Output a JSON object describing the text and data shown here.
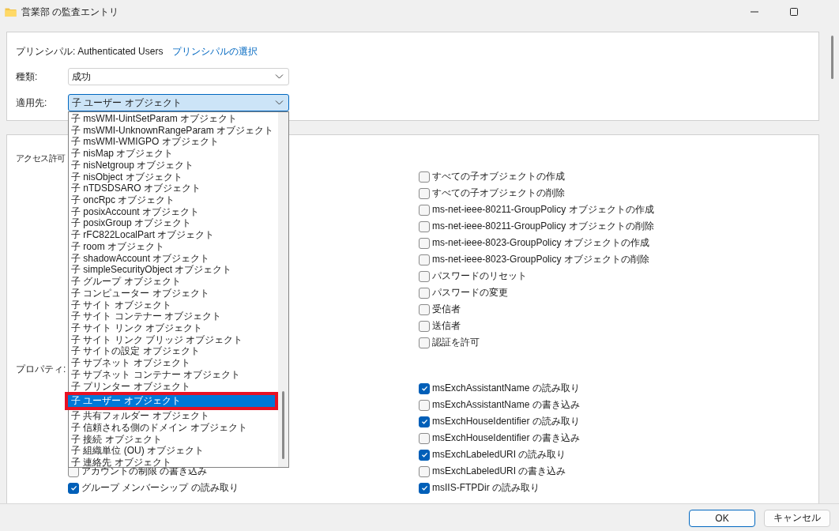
{
  "window": {
    "title": "営業部 の監査エントリ"
  },
  "principal": {
    "label": "プリンシパル:",
    "value": "Authenticated Users",
    "link": "プリンシパルの選択"
  },
  "type": {
    "label": "種類:",
    "value": "成功"
  },
  "applies_to": {
    "label": "適用先:",
    "value": "子 ユーザー オブジェクト",
    "expanded": true,
    "options": [
      {
        "label": "子 msWMI-UintSetParam オブジェクト",
        "selected": false,
        "highlighted": false
      },
      {
        "label": "子 msWMI-UnknownRangeParam オブジェクト",
        "selected": false,
        "highlighted": false
      },
      {
        "label": "子 msWMI-WMIGPO オブジェクト",
        "selected": false,
        "highlighted": false
      },
      {
        "label": "子 nisMap オブジェクト",
        "selected": false,
        "highlighted": false
      },
      {
        "label": "子 nisNetgroup オブジェクト",
        "selected": false,
        "highlighted": false
      },
      {
        "label": "子 nisObject オブジェクト",
        "selected": false,
        "highlighted": false
      },
      {
        "label": "子 nTDSDSARO オブジェクト",
        "selected": false,
        "highlighted": false
      },
      {
        "label": "子 oncRpc オブジェクト",
        "selected": false,
        "highlighted": false
      },
      {
        "label": "子 posixAccount オブジェクト",
        "selected": false,
        "highlighted": false
      },
      {
        "label": "子 posixGroup オブジェクト",
        "selected": false,
        "highlighted": false
      },
      {
        "label": "子 rFC822LocalPart オブジェクト",
        "selected": false,
        "highlighted": false
      },
      {
        "label": "子 room オブジェクト",
        "selected": false,
        "highlighted": false
      },
      {
        "label": "子 shadowAccount オブジェクト",
        "selected": false,
        "highlighted": false
      },
      {
        "label": "子 simpleSecurityObject オブジェクト",
        "selected": false,
        "highlighted": false
      },
      {
        "label": "子 グループ オブジェクト",
        "selected": false,
        "highlighted": false
      },
      {
        "label": "子 コンピューター オブジェクト",
        "selected": false,
        "highlighted": false
      },
      {
        "label": "子 サイト オブジェクト",
        "selected": false,
        "highlighted": false
      },
      {
        "label": "子 サイト コンテナー オブジェクト",
        "selected": false,
        "highlighted": false
      },
      {
        "label": "子 サイト リンク オブジェクト",
        "selected": false,
        "highlighted": false
      },
      {
        "label": "子 サイト リンク ブリッジ オブジェクト",
        "selected": false,
        "highlighted": false
      },
      {
        "label": "子 サイトの設定 オブジェクト",
        "selected": false,
        "highlighted": false
      },
      {
        "label": "子 サブネット オブジェクト",
        "selected": false,
        "highlighted": false
      },
      {
        "label": "子 サブネット コンテナー オブジェクト",
        "selected": false,
        "highlighted": false
      },
      {
        "label": "子 プリンター オブジェクト",
        "selected": false,
        "highlighted": false
      },
      {
        "label": "子 ユーザー オブジェクト",
        "selected": true,
        "highlighted": true
      },
      {
        "label": "子 共有フォルダー オブジェクト",
        "selected": false,
        "highlighted": false
      },
      {
        "label": "子 信頼される側のドメイン オブジェクト",
        "selected": false,
        "highlighted": false
      },
      {
        "label": "子 接続 オブジェクト",
        "selected": false,
        "highlighted": false
      },
      {
        "label": "子 組織単位 (OU) オブジェクト",
        "selected": false,
        "highlighted": false
      },
      {
        "label": "子 連絡先 オブジェクト",
        "selected": false,
        "highlighted": false
      }
    ]
  },
  "permissions": {
    "label": "アクセス許可",
    "items": [
      {
        "label": "すべての子オブジェクトの作成",
        "checked": false
      },
      {
        "label": "すべての子オブジェクトの削除",
        "checked": false
      },
      {
        "label": "ms-net-ieee-80211-GroupPolicy オブジェクトの作成",
        "checked": false
      },
      {
        "label": "ms-net-ieee-80211-GroupPolicy オブジェクトの削除",
        "checked": false
      },
      {
        "label": "ms-net-ieee-8023-GroupPolicy オブジェクトの作成",
        "checked": false
      },
      {
        "label": "ms-net-ieee-8023-GroupPolicy オブジェクトの削除",
        "checked": false
      },
      {
        "label": "パスワードのリセット",
        "checked": false
      },
      {
        "label": "パスワードの変更",
        "checked": false
      },
      {
        "label": "受信者",
        "checked": false
      },
      {
        "label": "送信者",
        "checked": false
      },
      {
        "label": "認証を許可",
        "checked": false
      }
    ]
  },
  "properties": {
    "label": "プロパティ:",
    "left_items": [
      {
        "label": "アカウントの制限 の書き込み",
        "checked": false
      },
      {
        "label": "グループ メンバーシップ の読み取り",
        "checked": true
      }
    ],
    "right_items": [
      {
        "label": "msExchAssistantName の読み取り",
        "checked": true
      },
      {
        "label": "msExchAssistantName の書き込み",
        "checked": false
      },
      {
        "label": "msExchHouseIdentifier の読み取り",
        "checked": true
      },
      {
        "label": "msExchHouseIdentifier の書き込み",
        "checked": false
      },
      {
        "label": "msExchLabeledURI の読み取り",
        "checked": true
      },
      {
        "label": "msExchLabeledURI の書き込み",
        "checked": false
      },
      {
        "label": "msIIS-FTPDir の読み取り",
        "checked": true
      }
    ]
  },
  "buttons": [
    {
      "label": "OK",
      "default": true
    },
    {
      "label": "キャンセル",
      "default": false
    }
  ]
}
